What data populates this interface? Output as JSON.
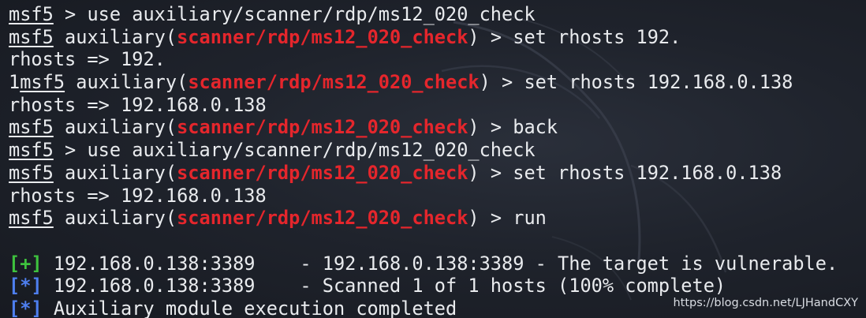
{
  "terminal": {
    "lines": [
      {
        "prompt": "msf5",
        "text": " > use auxiliary/scanner/rdp/ms12_020_check"
      },
      {
        "prompt": "msf5",
        "pre": " auxiliary(",
        "module": "scanner/rdp/ms12_020_check",
        "post": ") > set rhosts 192."
      },
      {
        "text": "rhosts => 192."
      },
      {
        "lead": "1",
        "prompt": "msf5",
        "pre": " auxiliary(",
        "module": "scanner/rdp/ms12_020_check",
        "post": ") > set rhosts 192.168.0.138"
      },
      {
        "text": "rhosts => 192.168.0.138"
      },
      {
        "prompt": "msf5",
        "pre": " auxiliary(",
        "module": "scanner/rdp/ms12_020_check",
        "post": ") > back"
      },
      {
        "prompt": "msf5",
        "text": " > use auxiliary/scanner/rdp/ms12_020_check"
      },
      {
        "prompt": "msf5",
        "pre": " auxiliary(",
        "module": "scanner/rdp/ms12_020_check",
        "post": ") > set rhosts 192.168.0.138"
      },
      {
        "text": "rhosts => 192.168.0.138"
      },
      {
        "prompt": "msf5",
        "pre": " auxiliary(",
        "module": "scanner/rdp/ms12_020_check",
        "post": ") > run"
      },
      {
        "text": ""
      },
      {
        "marker": "[+]",
        "marker_type": "success",
        "text": " 192.168.0.138:3389    - 192.168.0.138:3389 - The target is vulnerable."
      },
      {
        "marker": "[*]",
        "marker_type": "info",
        "text": " 192.168.0.138:3389    - Scanned 1 of 1 hosts (100% complete)"
      },
      {
        "marker": "[*]",
        "marker_type": "info",
        "text": " Auxiliary module execution completed"
      }
    ]
  },
  "watermark": "https://blog.csdn.net/LJHandCXY",
  "colors": {
    "background": "#1f232c",
    "text": "#e9ebee",
    "module": "#e5262c",
    "success": "#3ec23e",
    "info": "#4e7ff0"
  }
}
